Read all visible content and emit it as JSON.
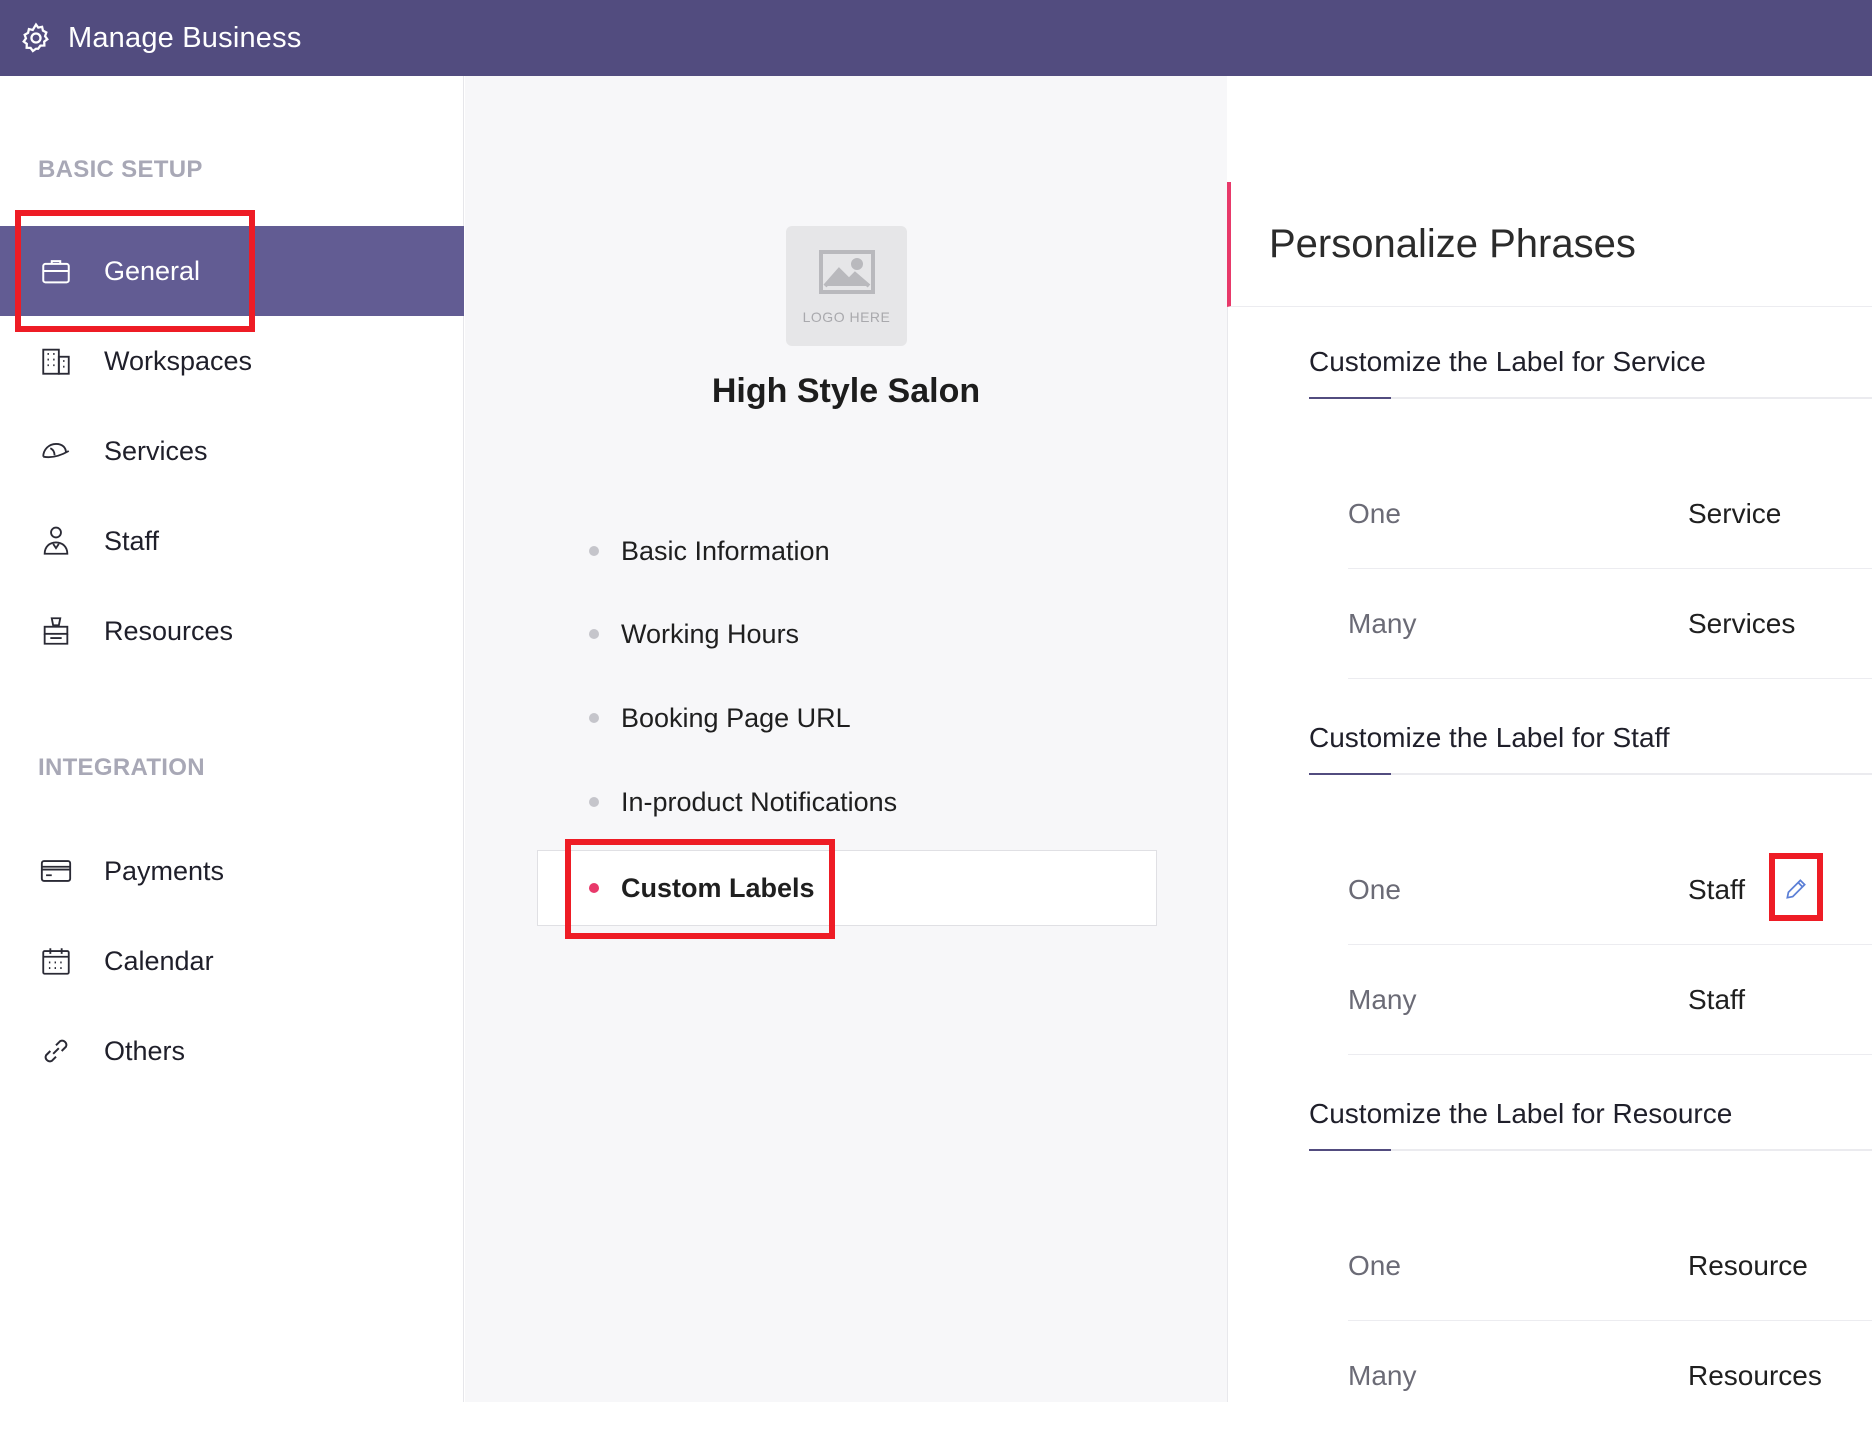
{
  "app": {
    "title": "Manage Business"
  },
  "sidebar": {
    "sections": [
      {
        "title": "BASIC SETUP"
      },
      {
        "title": "INTEGRATION"
      }
    ],
    "basic_items": [
      {
        "label": "General",
        "icon": "briefcase-icon",
        "active": true
      },
      {
        "label": "Workspaces",
        "icon": "building-icon"
      },
      {
        "label": "Services",
        "icon": "cap-icon"
      },
      {
        "label": "Staff",
        "icon": "person-icon"
      },
      {
        "label": "Resources",
        "icon": "chair-icon"
      }
    ],
    "integration_items": [
      {
        "label": "Payments",
        "icon": "card-icon"
      },
      {
        "label": "Calendar",
        "icon": "calendar-icon"
      },
      {
        "label": "Others",
        "icon": "link-icon"
      }
    ]
  },
  "business": {
    "logo_placeholder": "LOGO HERE",
    "name": "High Style Salon"
  },
  "general_menu": [
    {
      "label": "Basic Information"
    },
    {
      "label": "Working Hours"
    },
    {
      "label": "Booking Page URL"
    },
    {
      "label": "In-product Notifications"
    },
    {
      "label": "Custom Labels",
      "active": true
    }
  ],
  "personalize": {
    "title": "Personalize Phrases",
    "groups": [
      {
        "title": "Customize the Label for Service",
        "rows": [
          {
            "key": "One",
            "value": "Service"
          },
          {
            "key": "Many",
            "value": "Services"
          }
        ]
      },
      {
        "title": "Customize the Label for Staff",
        "rows": [
          {
            "key": "One",
            "value": "Staff"
          },
          {
            "key": "Many",
            "value": "Staff"
          }
        ]
      },
      {
        "title": "Customize the Label for Resource",
        "rows": [
          {
            "key": "One",
            "value": "Resource"
          },
          {
            "key": "Many",
            "value": "Resources"
          }
        ]
      }
    ]
  },
  "colors": {
    "header": "#524c7f",
    "active_nav": "#625c93",
    "accent": "#e8396a",
    "highlight": "#ee1c25"
  }
}
